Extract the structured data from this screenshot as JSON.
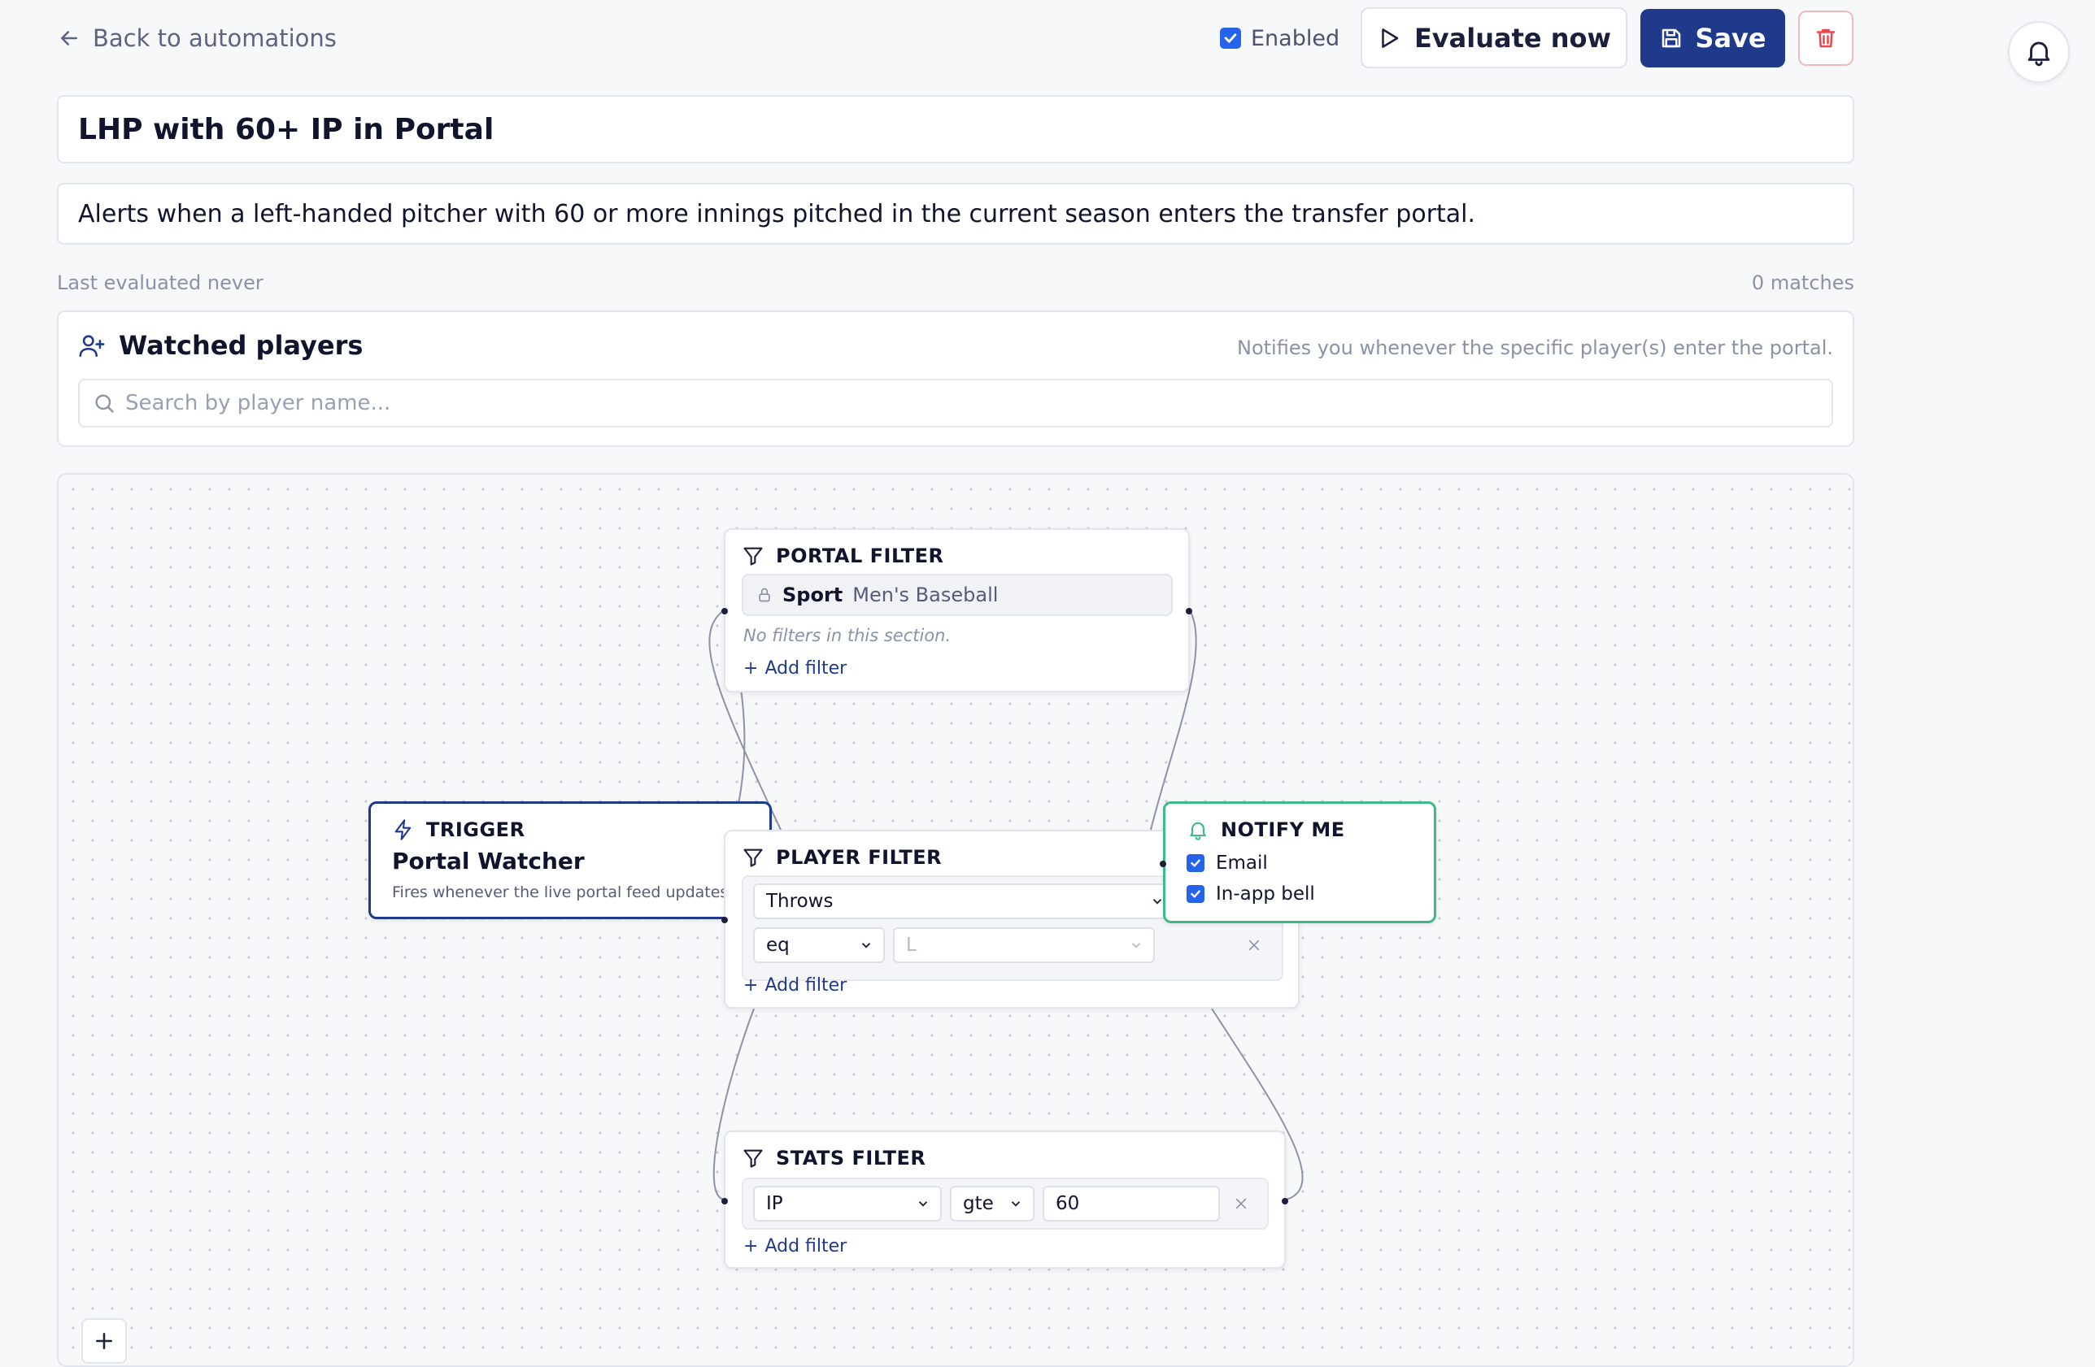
{
  "header": {
    "back_label": "Back to automations",
    "enabled_label": "Enabled",
    "enabled_checked": true,
    "evaluate_label": "Evaluate now",
    "save_label": "Save"
  },
  "automation": {
    "title": "LHP with 60+ IP in Portal",
    "description": "Alerts when a left-handed pitcher with 60 or more innings pitched in the current season enters the transfer portal.",
    "last_evaluated": "Last evaluated never",
    "matches": "0 matches"
  },
  "watched_players": {
    "heading": "Watched players",
    "hint": "Notifies you whenever the specific player(s) enter the portal.",
    "search_placeholder": "Search by player name..."
  },
  "canvas": {
    "portal_filter": {
      "heading": "PORTAL FILTER",
      "locked_key": "Sport",
      "locked_value": "Men's Baseball",
      "empty_text": "No filters in this section.",
      "add_label": "Add filter"
    },
    "trigger": {
      "heading": "TRIGGER",
      "title": "Portal Watcher",
      "description": "Fires whenever the live portal feed updates"
    },
    "player_filter": {
      "heading": "PLAYER FILTER",
      "field": "Throws",
      "operator": "eq",
      "value": "L",
      "add_label": "Add filter"
    },
    "notify": {
      "heading": "NOTIFY ME",
      "options": [
        {
          "label": "Email",
          "checked": true
        },
        {
          "label": "In-app bell",
          "checked": true
        }
      ]
    },
    "stats_filter": {
      "heading": "STATS FILTER",
      "field": "IP",
      "operator": "gte",
      "value": "60",
      "add_label": "Add filter"
    }
  },
  "colors": {
    "accent": "#1f3a8a",
    "checkbox": "#2563eb",
    "notify_border": "#3dba85",
    "danger": "#e5484d"
  },
  "icons": {
    "back": "arrow-left-icon",
    "evaluate": "play-icon",
    "save": "floppy-disk-icon",
    "delete": "trash-icon",
    "notifications": "bell-icon",
    "watched": "user-plus-icon",
    "search": "search-icon",
    "filter": "funnel-icon",
    "trigger": "lightning-icon",
    "notify": "bell-icon",
    "lock": "lock-icon",
    "zoom_in": "plus-icon"
  }
}
